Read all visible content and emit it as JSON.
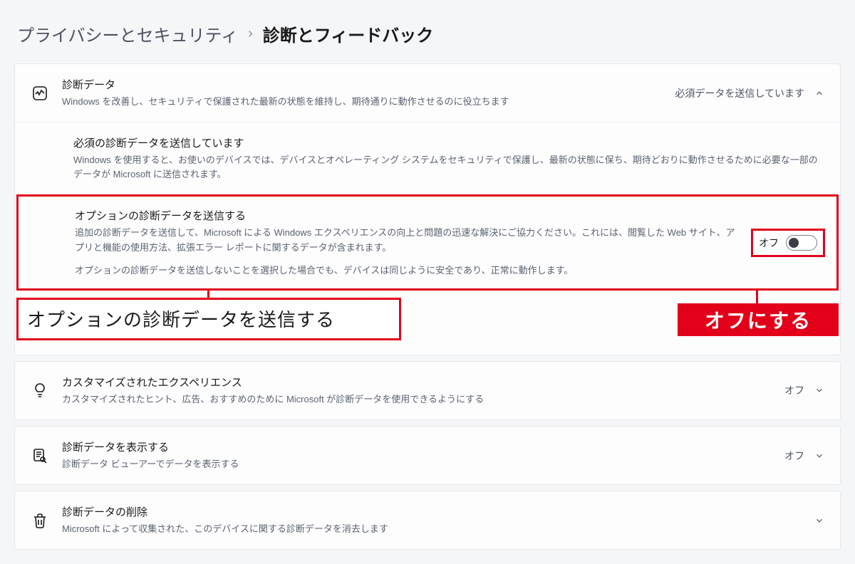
{
  "breadcrumb": {
    "parent": "プライバシーとセキュリティ",
    "separator": "›",
    "current": "診断とフィードバック"
  },
  "diag_data": {
    "title": "診断データ",
    "desc": "Windows を改善し、セキュリティで保護された最新の状態を維持し、期待通りに動作させるのに役立ちます",
    "status": "必須データを送信しています"
  },
  "required": {
    "title": "必須の診断データを送信しています",
    "desc": "Windows を使用すると、お使いのデバイスでは、デバイスとオペレーティング システムをセキュリティで保護し、最新の状態に保ち、期待どおりに動作させるために必要な一部のデータが Microsoft に送信されます。"
  },
  "optional": {
    "title": "オプションの診断データを送信する",
    "desc": "追加の診断データを送信して、Microsoft による Windows エクスペリエンスの向上と問題の迅速な解決にご協力ください。これには、閲覧した Web サイト、アプリと機能の使用方法、拡張エラー レポートに関するデータが含まれます。",
    "note": "オプションの診断データを送信しないことを選択した場合でも、デバイスは同じように安全であり、正常に動作します。",
    "toggle_label": "オフ"
  },
  "annotations": {
    "left": "オプションの診断データを送信する",
    "right": "オフにする"
  },
  "tailored": {
    "title": "カスタマイズされたエクスペリエンス",
    "desc": "カスタマイズされたヒント、広告、おすすめのために Microsoft が診断データを使用できるようにする",
    "status": "オフ"
  },
  "view": {
    "title": "診断データを表示する",
    "desc": "診断データ ビューアーでデータを表示する",
    "status": "オフ"
  },
  "delete": {
    "title": "診断データの削除",
    "desc": "Microsoft によって収集された、このデバイスに関する診断データを消去します"
  }
}
